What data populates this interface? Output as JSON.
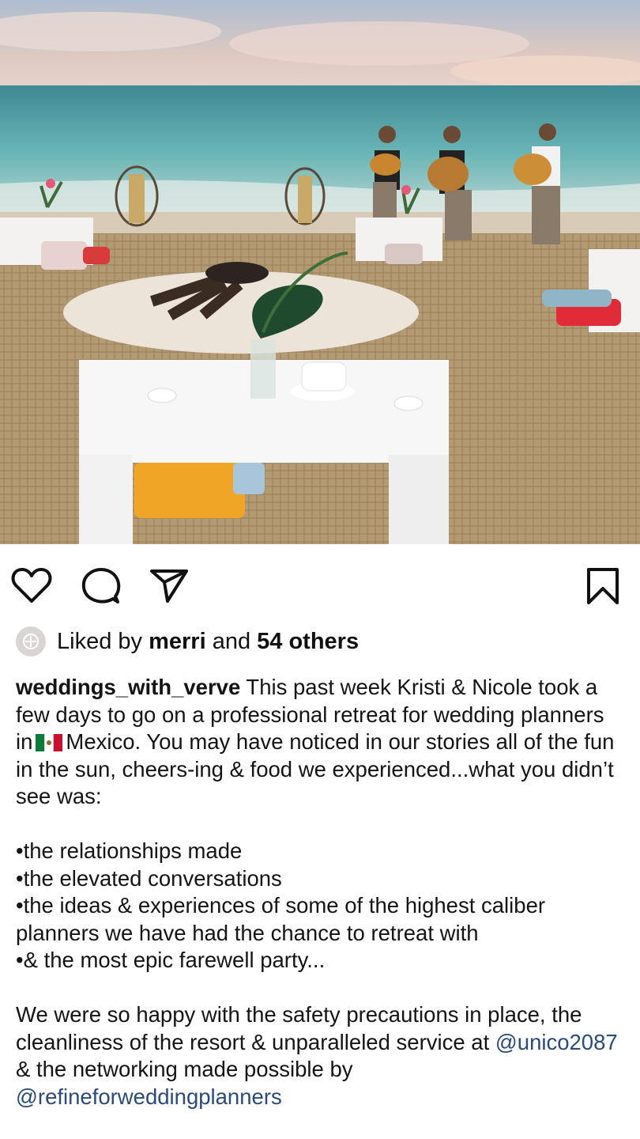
{
  "post": {
    "image_alt": "Beach setup with low white tables, woven mats, fire pit and mariachi musicians",
    "actions": {
      "like_icon": "heart-outline-icon",
      "comment_icon": "comment-bubble-icon",
      "share_icon": "paper-plane-icon",
      "save_icon": "bookmark-outline-icon"
    },
    "likes": {
      "prefix": "Liked by",
      "user": "merri",
      "joiner": "and",
      "others": "54 others"
    },
    "caption": {
      "username": "weddings_with_verve",
      "intro_a": "This past week Kristi & Nicole took a few days to go on a professional retreat for wedding planners in",
      "flag": "🇲🇽",
      "intro_b": "Mexico.  You may have noticed in our stories all of the fun in the sun, cheers-ing & food we experienced...what you didn’t see was:",
      "bullets": [
        "•the relationships made",
        "•the elevated conversations",
        "•the ideas & experiences of some of the highest caliber planners we have had the chance to retreat with",
        "•& the most epic farewell party..."
      ],
      "para2_a": "We were so happy with the safety precautions in place, the cleanliness of the resort & unparalleled service at",
      "mention1": "@unico2087",
      "para2_b": "& the networking made possible by",
      "mention2": "@refineforweddingplanners"
    },
    "colors": {
      "link": "#2b4a7a",
      "text": "#141414"
    }
  }
}
